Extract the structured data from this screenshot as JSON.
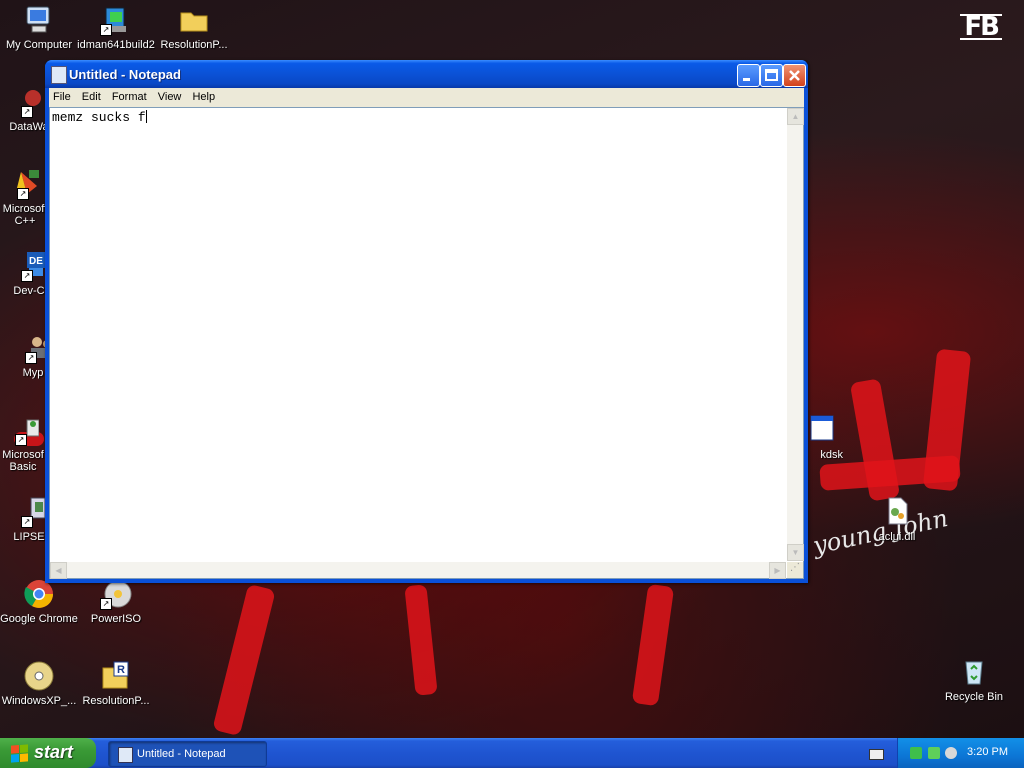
{
  "desktop": {
    "icons": [
      {
        "label": "My Computer"
      },
      {
        "label": "idman641build2"
      },
      {
        "label": "ResolutionP..."
      },
      {
        "label": "DataWa"
      },
      {
        "label": "Microsoft"
      },
      {
        "label": "C++"
      },
      {
        "label": "Dev-C"
      },
      {
        "label": "Myp"
      },
      {
        "label": "Microsof"
      },
      {
        "label": "Basic"
      },
      {
        "label": "LIPSE"
      },
      {
        "label": "Google Chrome"
      },
      {
        "label": "PowerISO"
      },
      {
        "label": "WindowsXP_..."
      },
      {
        "label": "ResolutionP..."
      },
      {
        "label": "kdsk"
      },
      {
        "label": "aclui.dll"
      },
      {
        "label": "Recycle Bin"
      }
    ],
    "wallpaper_logo": "FB"
  },
  "notepad": {
    "title": "Untitled - Notepad",
    "menu": [
      "File",
      "Edit",
      "Format",
      "View",
      "Help"
    ],
    "content": "memz sucks f"
  },
  "taskbar": {
    "start_label": "start",
    "tasks": [
      {
        "label": "Untitled - Notepad"
      }
    ],
    "clock": "3:20 PM"
  },
  "colors": {
    "taskbar_blue": "#245edb",
    "start_green": "#3a9a36",
    "titlebar_blue": "#0b52d6",
    "close_red": "#d2421c",
    "tray_blue": "#0c76d6"
  }
}
